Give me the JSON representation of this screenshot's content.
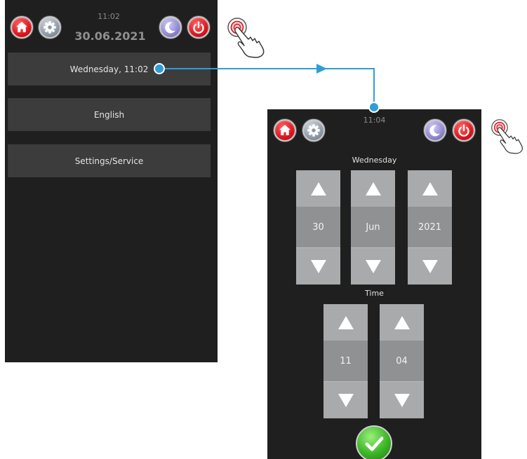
{
  "left_screen": {
    "time": "11:02",
    "date": "30.06.2021",
    "menu": [
      {
        "label": "Wednesday, 11:02"
      },
      {
        "label": "English"
      },
      {
        "label": "Settings/Service"
      }
    ],
    "icons": {
      "home": "home-icon",
      "settings": "gear-icon",
      "standby": "moon-icon",
      "power": "power-icon"
    }
  },
  "right_screen": {
    "time": "11:04",
    "weekday": "Wednesday",
    "date_spinners": [
      {
        "value": "30"
      },
      {
        "value": "Jun"
      },
      {
        "value": "2021"
      }
    ],
    "time_label": "Time",
    "time_spinners": [
      {
        "value": "11"
      },
      {
        "value": "04"
      }
    ],
    "confirm_icon": "checkmark-icon"
  },
  "colors": {
    "screen_bg": "#1f1f1f",
    "menu_row": "#3c3c3c",
    "spinner_arrow": "#a8aaab",
    "spinner_value": "#8f9193",
    "connector": "#2f9ed8",
    "home": "#d9141c",
    "power": "#d9141c",
    "confirm": "#3cb526"
  }
}
